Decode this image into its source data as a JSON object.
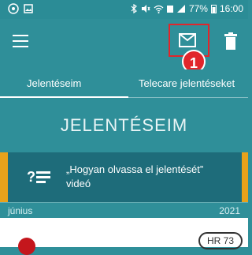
{
  "status_bar": {
    "battery": "77%",
    "time": "16:00"
  },
  "toolbar": {
    "callout_number": "1"
  },
  "tabs": [
    {
      "label": "Jelentéseim",
      "active": true
    },
    {
      "label": "Telecare jelentéseket",
      "active": false
    }
  ],
  "main": {
    "heading": "JELENTÉSEIM",
    "video_card": {
      "text": "„Hogyan olvassa el jelentését” videó"
    },
    "date_bar": {
      "month": "június",
      "year": "2021"
    },
    "report": {
      "badge": "HR 73"
    }
  },
  "colors": {
    "primary": "#2f8f99",
    "card": "#1e6c7a",
    "accent_orange": "#e8a21b",
    "highlight_red": "#e1262b"
  }
}
